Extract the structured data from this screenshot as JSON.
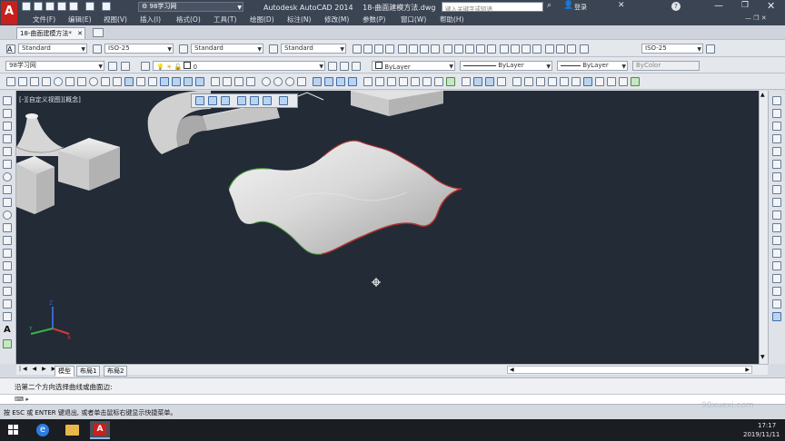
{
  "window": {
    "app_title": "Autodesk AutoCAD 2014",
    "file_title": "18-曲面建模方法.dwg",
    "workspace": "98学习网",
    "search_placeholder": "键入关键字或短语",
    "login": "登录"
  },
  "menu": [
    "文件(F)",
    "编辑(E)",
    "视图(V)",
    "插入(I)",
    "格式(O)",
    "工具(T)",
    "绘图(D)",
    "标注(N)",
    "修改(M)",
    "参数(P)",
    "窗口(W)",
    "帮助(H)"
  ],
  "file_tab": "18-曲面建模方法*",
  "styles": {
    "text_style": "Standard",
    "dim_style": "ISO-25",
    "table_style": "Standard",
    "mleader_style": "Standard",
    "dim_style2": "ISO-25"
  },
  "layers": {
    "workspace_combo": "98学习网",
    "current_layer": "0",
    "color": "ByLayer",
    "linetype": "ByLayer",
    "lineweight": "ByLayer",
    "plotstyle": "ByColor"
  },
  "viewport": {
    "label": "[-][自定义视图][概念]"
  },
  "layout_tabs": [
    "模型",
    "布局1",
    "布局2"
  ],
  "command": {
    "prompt": "沿第二个方向选择曲线或曲面边:",
    "input_prefix": "⌨ ▸"
  },
  "status": {
    "message": "按 ESC 或 ENTER 键退出, 或者单击鼠标右键显示快捷菜单。"
  },
  "taskbar": {
    "time": "17:17",
    "date": "2019/11/11",
    "watermark": "98xuexi.com"
  },
  "colors": {
    "viewport_bg": "#222b36",
    "title_bg": "#3b4452",
    "accent_red": "#c8201c"
  }
}
